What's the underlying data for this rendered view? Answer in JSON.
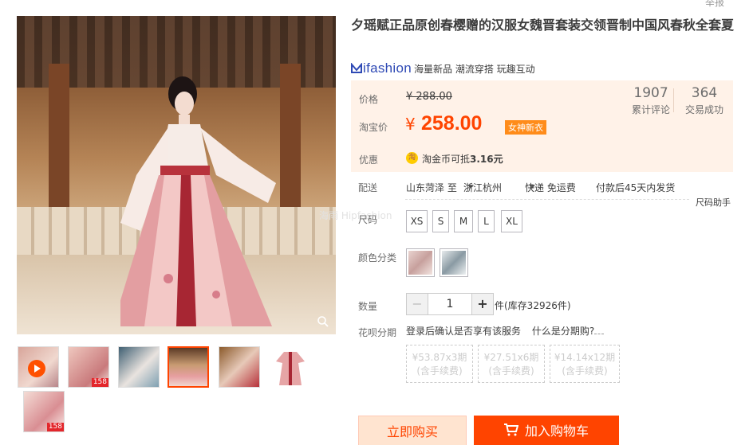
{
  "header": {
    "report_label": "举报"
  },
  "gallery": {
    "thumbnails": [
      {
        "kind": "video",
        "tag": ""
      },
      {
        "kind": "image",
        "tag": "158"
      },
      {
        "kind": "image",
        "tag": ""
      },
      {
        "kind": "image",
        "tag": "",
        "selected": true
      },
      {
        "kind": "image",
        "tag": ""
      },
      {
        "kind": "image",
        "tag": ""
      },
      {
        "kind": "image",
        "tag": "158"
      }
    ]
  },
  "product": {
    "title": "夕瑶赋正品原创春樱赠的汉服女魏晋套装交领晋制中国风春秋全套夏",
    "brand_logo": "ifashion",
    "brand_tags": "海量新品 潮流穿搭 玩趣互动"
  },
  "pricing": {
    "price_label": "价格",
    "original_price": "¥ 288.00",
    "taobao_price_label": "淘宝价",
    "currency": "¥",
    "price": "258.00",
    "badge": "女神新衣",
    "reviews_count": "1907",
    "reviews_label": "累计评论",
    "sales_count": "364",
    "sales_label": "交易成功",
    "promo_label": "优惠",
    "coin_icon_text": "淘",
    "coin_text_prefix": "淘金币可抵",
    "coin_amount": "3.16元"
  },
  "shipping": {
    "label": "配送",
    "from": "山东菏泽 至",
    "to": "浙江杭州",
    "method": "快递 免运费",
    "dispatch": "付款后45天内发货",
    "size_helper": "尺码助手"
  },
  "watermark": "海雨 Hipfashion",
  "size": {
    "label": "尺码",
    "options": [
      "XS",
      "S",
      "M",
      "L",
      "XL"
    ]
  },
  "color": {
    "label": "颜色分类",
    "swatches": [
      "#c7a09d",
      "#8a9aa3"
    ]
  },
  "quantity": {
    "label": "数量",
    "minus": "−",
    "value": "1",
    "plus": "+",
    "stock": "件(库存32926件)"
  },
  "installment": {
    "label": "花呗分期",
    "login_text": "登录后确认是否享有该服务",
    "what_link": "什么是分期购?",
    "options": [
      {
        "amount": "¥53.87x3期",
        "fee": "(含手续费)"
      },
      {
        "amount": "¥27.51x6期",
        "fee": "(含手续费)"
      },
      {
        "amount": "¥14.14x12期",
        "fee": "(含手续费)"
      }
    ]
  },
  "actions": {
    "buy_now": "立即购买",
    "add_to_cart": "加入购物车"
  },
  "colors": {
    "accent": "#ff4400",
    "price": "#ff4400",
    "brand": "#2f4ab5",
    "price_bg": "#fff2e8"
  }
}
